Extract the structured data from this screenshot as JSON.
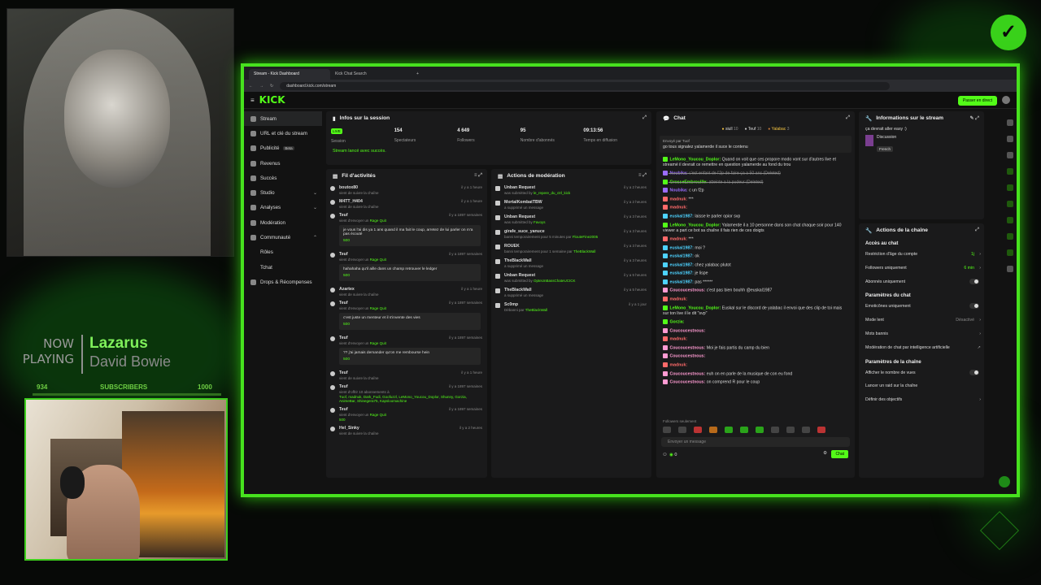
{
  "overlay": {
    "now_playing": "NOW\nPLAYING",
    "now": "NOW",
    "playing": "PLAYING",
    "song_title": "Lazarus",
    "song_artist": "David Bowie",
    "subs_current": "934",
    "subs_label": "SUBSCRIBERS",
    "subs_goal": "1000",
    "colors": {
      "accent": "#53fc18",
      "frame": "#47e21e"
    }
  },
  "browser": {
    "tab1": "Stream - Kick Dashboard",
    "tab2": "Kick Chat Search",
    "url": "dashboard.kick.com/stream"
  },
  "topbar": {
    "logo": "KICK",
    "go_live": "Passer en direct"
  },
  "nav": [
    {
      "label": "Stream"
    },
    {
      "label": "URL et clé du stream"
    },
    {
      "label": "Publicité",
      "badge": "Beta"
    },
    {
      "label": "Revenus"
    },
    {
      "label": "Succès"
    },
    {
      "label": "Studio"
    },
    {
      "label": "Analyses"
    },
    {
      "label": "Modération"
    },
    {
      "label": "Communauté"
    },
    {
      "label": "Rôles"
    },
    {
      "label": "Tchat"
    },
    {
      "label": "Drops & Récompenses"
    }
  ],
  "session": {
    "title": "Infos sur la session",
    "live_badge": "LIVE",
    "stats": [
      {
        "value": "",
        "label": "Session"
      },
      {
        "value": "154",
        "label": "Spectateurs"
      },
      {
        "value": "4 649",
        "label": "Followers"
      },
      {
        "value": "95",
        "label": "Nombre d'abonnés"
      },
      {
        "value": "09:13:56",
        "label": "Temps en diffusion"
      }
    ],
    "status": "Stream lancé avec succès."
  },
  "activity": {
    "title": "Fil d'activités",
    "items": [
      {
        "user": "boutox80",
        "sub": "vient de suivre la chaîne",
        "time": "il y a 1 heure"
      },
      {
        "user": "M4TT_H404",
        "sub": "vient de suivre la chaîne",
        "time": "il y a 1 heure"
      },
      {
        "user": "Teuf",
        "sub": "vient d'envoyer un",
        "gift": "Rage Quit",
        "time": "il y a 1897 semaines",
        "quote": "je vous l'ai dis ya 1 ans quand il ma fait le coup, arretez de lui parler on m'a pas écouté",
        "amount": "500"
      },
      {
        "user": "Teuf",
        "sub": "vient d'envoyer un",
        "gift": "Rage Quit",
        "time": "il y a 1897 semaines",
        "quote": "hahahaha qu'il aille dans un champ retrouver le ledger",
        "amount": "500"
      },
      {
        "user": "Azartex",
        "sub": "vient de suivre la chaîne",
        "time": "il y a 1 heure"
      },
      {
        "user": "Teuf",
        "sub": "vient d'envoyer un",
        "gift": "Rage Quit",
        "time": "il y a 1897 semaines",
        "quote": "c'est juste un menteur et il s'invente des vies",
        "amount": "500"
      },
      {
        "user": "Teuf",
        "sub": "vient d'envoyer un",
        "gift": "Rage Quit",
        "time": "il y a 1897 semaines",
        "quote": "?? j'ai jamais demander qu'on me rembourse hein",
        "amount": "500"
      },
      {
        "user": "Teuf",
        "sub": "vient de suivre la chaîne",
        "time": "il y a 1 heure"
      },
      {
        "user": "Teuf",
        "sub": "vient d'offrir 10 abonnements à",
        "names": "Tuof, madnuk, Dark_Fudi, Goofuzzl, LeMono_Youcou_Doplor, Shunny, Gorzia, AnimeBar, Shinegera75, Kapsloomachine",
        "time": "il y a 1897 semaines"
      },
      {
        "user": "Teuf",
        "sub": "vient d'envoyer un",
        "gift": "Rage Quit",
        "time": "il y a 1897 semaines",
        "amount": "500"
      },
      {
        "user": "Hel_Sinky",
        "sub": "vient de suivre la chaîne",
        "time": "il y a 2 heures"
      }
    ]
  },
  "moderation": {
    "title": "Actions de modération",
    "items": [
      {
        "action": "Unban Request",
        "sub": "was submitted by",
        "who": "le_repere_du_ctrl_kick",
        "time": "il y a 2 heures"
      },
      {
        "action": "MortalKombatTBW",
        "sub": "a supprimé un message",
        "who": "",
        "time": "il y a 2 heures"
      },
      {
        "action": "Unban Request",
        "sub": "was submitted by",
        "who": "Favoys",
        "time": "il y a 3 heures"
      },
      {
        "action": "girafe_suce_yanuce",
        "sub": "banni temporairement pour 5 minutes par",
        "who": "FlouteFine2005",
        "time": "il y a 3 heures"
      },
      {
        "action": "ROUEK",
        "sub": "banni temporairement pour 1 semaine par",
        "who": "TheBlackWall",
        "time": "il y a 3 heures"
      },
      {
        "action": "TheBlackWall",
        "sub": "a supprimé un message",
        "who": "",
        "time": "il y a 3 heures"
      },
      {
        "action": "Unban Request",
        "sub": "was submitted by",
        "who": "OpteUnBassChateUCICK",
        "time": "il y a 5 heures"
      },
      {
        "action": "TheBlackWall",
        "sub": "a supprimé un message",
        "who": "",
        "time": "il y a 5 heures"
      },
      {
        "action": "Sc0mp",
        "sub": "Débanni par",
        "who": "TheBlackWall",
        "time": "il y a 1 jour"
      }
    ]
  },
  "chat": {
    "title": "Chat",
    "top": [
      {
        "name": "siull",
        "n": "10"
      },
      {
        "name": "Teuf",
        "n": "10"
      },
      {
        "name": "Yalabac",
        "n": "3"
      }
    ],
    "pinned_label": "Envoyé par Tuof",
    "pinned_text": "go tous signalez yalamerde il suce le contenu",
    "messages": [
      {
        "user": "LeMono_Youcou_Doplor:",
        "text": "Quand on voit que ces propore modo vont sur d'autres live et streamé il devrait ce remettre en question yalamerde au fond du trou",
        "color": "#53fc18"
      },
      {
        "user": "Noubika:",
        "text": "c'est enfant de l'2p de faire ça a 50 ans (Deleted)",
        "color": "#9b6dff",
        "del": true
      },
      {
        "user": "GrosseEmbrouille:",
        "text": "atteinte a la pudeur (Deleted)",
        "color": "#53fc18",
        "del": true
      },
      {
        "user": "Noubika:",
        "text": "c un f2p",
        "color": "#9b6dff"
      },
      {
        "user": "madnuk:",
        "text": "***",
        "color": "#ff6a6a"
      },
      {
        "user": "madnuk:",
        "text": "",
        "color": "#ff6a6a"
      },
      {
        "user": "euskal1987:",
        "text": "laisse le parler opior svp",
        "color": "#4dd2ff"
      },
      {
        "user": "LeMono_Youcou_Doplor:",
        "text": "Yalamerde il a 10 personne dans son chat chaque soir pour 140 viewer a part ce bot sa chaîne il fais rien de ces doigts",
        "color": "#53fc18"
      },
      {
        "user": "madnuk:",
        "text": "***",
        "color": "#ff6a6a"
      },
      {
        "user": "euskal1987:",
        "text": "moi ?",
        "color": "#4dd2ff"
      },
      {
        "user": "euskal1987:",
        "text": "ok",
        "color": "#4dd2ff"
      },
      {
        "user": "euskal1987:",
        "text": "chez yalabac plutot",
        "color": "#4dd2ff"
      },
      {
        "user": "euskal1987:",
        "text": "je lispe",
        "color": "#4dd2ff"
      },
      {
        "user": "euskal1987:",
        "text": "pas ******",
        "color": "#4dd2ff"
      },
      {
        "user": "Coucoucestnous:",
        "text": "c'est pas bien bouhh @euskal1987",
        "color": "#ff9bd2"
      },
      {
        "user": "madnuk:",
        "text": "",
        "color": "#ff6a6a"
      },
      {
        "user": "LeMono_Youcou_Doplor:",
        "text": "Euskal sur le discord de yalabac il envoi que des clip de toi mais sur ton live il le dit \"svp\"",
        "color": "#53fc18"
      },
      {
        "user": "Gorzia:",
        "text": "",
        "color": "#53fc18"
      },
      {
        "user": "Coucoucestnous:",
        "text": "",
        "color": "#ff9bd2"
      },
      {
        "user": "madnuk:",
        "text": "",
        "color": "#ff6a6a"
      },
      {
        "user": "Coucoucestnous:",
        "text": "Moi je fais partis du camp du bien",
        "color": "#ff9bd2"
      },
      {
        "user": "Coucoucestnous:",
        "text": "",
        "color": "#ff9bd2"
      },
      {
        "user": "madnuk:",
        "text": "",
        "color": "#ff6a6a"
      },
      {
        "user": "Coucoucestnous:",
        "text": "euh on en parle de la musique de con eu fond",
        "color": "#ff9bd2"
      },
      {
        "user": "Coucoucestnous:",
        "text": "on comprend R pour le coup",
        "color": "#ff9bd2"
      }
    ],
    "followers_mode": "Followers seulement",
    "input_placeholder": "Envoyer un message",
    "footer_count": "0",
    "send": "Chat"
  },
  "stream_info": {
    "title": "Informations sur le stream",
    "stream_title": "ça devrait aller easy :)",
    "category": "Discussion",
    "language": "French"
  },
  "channel": {
    "title": "Actions de la chaîne",
    "chat_access": "Accès au chat",
    "rows1": [
      {
        "label": "Restriction d'âge du compte",
        "value": "1j"
      },
      {
        "label": "Followers uniquement",
        "value": "6 min"
      },
      {
        "label": "Abonnés uniquement",
        "value": ""
      }
    ],
    "chat_params": "Paramètres du chat",
    "rows2": [
      {
        "label": "Emoticônes uniquement",
        "value": ""
      },
      {
        "label": "Mode lent",
        "value": "Désactivé"
      },
      {
        "label": "Mots bannis",
        "value": ""
      },
      {
        "label": "Modération de chat par intelligence artificielle",
        "value": ""
      }
    ],
    "channel_params": "Paramètres de la chaîne",
    "rows3": [
      {
        "label": "Afficher le nombre de vues",
        "value": ""
      },
      {
        "label": "Lancer un raid sur la chaîne",
        "value": ""
      },
      {
        "label": "Définir des objectifs",
        "value": ""
      }
    ]
  }
}
